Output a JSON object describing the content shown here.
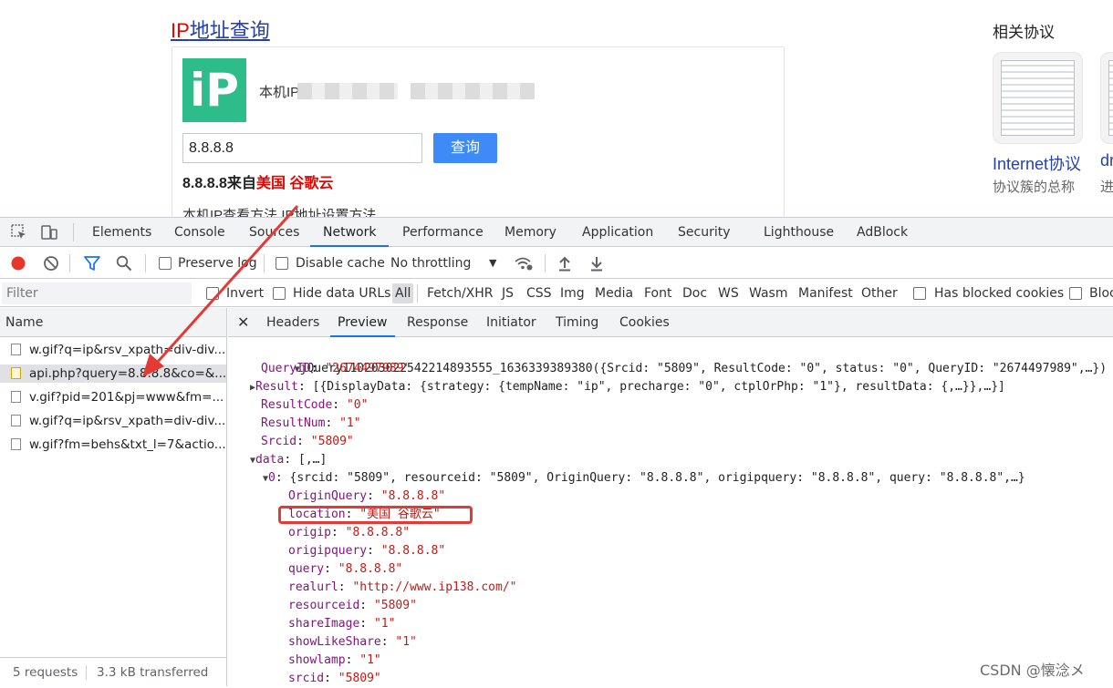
{
  "webpage": {
    "title_ip": "IP",
    "title_rest": "地址查询",
    "logo_text": "iP",
    "local_ip_label": "本机IP",
    "search_value": "8.8.8.8",
    "search_button": "查询",
    "result_prefix": "8.8.8.8来自",
    "result_location": "美国 谷歌云",
    "method_text": "本机IP查看方法 IP地址设置方法",
    "side_title": "相关协议",
    "side_link": "Internet协议",
    "side_link2": "dr",
    "side_desc": "协议簇的总称",
    "side_desc2": "进"
  },
  "devtools": {
    "tabs": [
      "Elements",
      "Console",
      "Sources",
      "Network",
      "Performance",
      "Memory",
      "Application",
      "Security",
      "Lighthouse",
      "AdBlock"
    ],
    "active_tab": "Network",
    "toolbar": {
      "preserve_log": "Preserve log",
      "disable_cache": "Disable cache",
      "throttling": "No throttling"
    },
    "filter": {
      "placeholder": "Filter",
      "invert": "Invert",
      "hide_data_urls": "Hide data URLs",
      "types": [
        "All",
        "Fetch/XHR",
        "JS",
        "CSS",
        "Img",
        "Media",
        "Font",
        "Doc",
        "WS",
        "Wasm",
        "Manifest",
        "Other"
      ],
      "has_blocked_cookies": "Has blocked cookies",
      "blocked_requests": "Bloc"
    },
    "requests_header": "Name",
    "requests": [
      {
        "name": "w.gif?q=ip&rsv_xpath=div-div...",
        "type": "file"
      },
      {
        "name": "api.php?query=8.8.8.8&co=&...",
        "type": "script"
      },
      {
        "name": "v.gif?pid=201&pj=www&fm=...",
        "type": "file"
      },
      {
        "name": "w.gif?q=ip&rsv_xpath=div-div...",
        "type": "file"
      },
      {
        "name": "w.gif?fm=behs&txt_l=7&actio...",
        "type": "file"
      }
    ],
    "summary_requests": "5 requests",
    "summary_transferred": "3.3 kB transferred",
    "detail_tabs": [
      "Headers",
      "Preview",
      "Response",
      "Initiator",
      "Timing",
      "Cookies"
    ],
    "active_detail_tab": "Preview",
    "preview": {
      "root": "jQuery110203022542214893555_1636339389380({Srcid: \"5809\", ResultCode: \"0\", status: \"0\", QueryID: \"2674497989\",…})",
      "lines": [
        {
          "key": "QueryID",
          "value": "\"2674497989\"",
          "indent": 1,
          "toggle": ""
        },
        {
          "key": "Result",
          "value": "[{DisplayData: {strategy: {tempName: \"ip\", precharge: \"0\", ctplOrPhp: \"1\"}, resultData: {,…}},…}]",
          "indent": 1,
          "toggle": "▶"
        },
        {
          "key": "ResultCode",
          "value": "\"0\"",
          "indent": 1,
          "toggle": ""
        },
        {
          "key": "ResultNum",
          "value": "\"1\"",
          "indent": 1,
          "toggle": ""
        },
        {
          "key": "Srcid",
          "value": "\"5809\"",
          "indent": 1,
          "toggle": ""
        },
        {
          "key": "data",
          "value": "[,…]",
          "indent": 1,
          "toggle": "▼"
        },
        {
          "key": "0",
          "value": "{srcid: \"5809\", resourceid: \"5809\", OriginQuery: \"8.8.8.8\", origipquery: \"8.8.8.8\", query: \"8.8.8.8\",…}",
          "indent": 2,
          "toggle": "▼"
        },
        {
          "key": "OriginQuery",
          "value": "\"8.8.8.8\"",
          "indent": 3,
          "toggle": ""
        },
        {
          "key": "location",
          "value": "\"美国 谷歌云\"",
          "indent": 3,
          "toggle": ""
        },
        {
          "key": "origip",
          "value": "\"8.8.8.8\"",
          "indent": 3,
          "toggle": ""
        },
        {
          "key": "origipquery",
          "value": "\"8.8.8.8\"",
          "indent": 3,
          "toggle": ""
        },
        {
          "key": "query",
          "value": "\"8.8.8.8\"",
          "indent": 3,
          "toggle": ""
        },
        {
          "key": "realurl",
          "value": "\"http://www.ip138.com/\"",
          "indent": 3,
          "toggle": ""
        },
        {
          "key": "resourceid",
          "value": "\"5809\"",
          "indent": 3,
          "toggle": ""
        },
        {
          "key": "shareImage",
          "value": "\"1\"",
          "indent": 3,
          "toggle": ""
        },
        {
          "key": "showLikeShare",
          "value": "\"1\"",
          "indent": 3,
          "toggle": ""
        },
        {
          "key": "showlamp",
          "value": "\"1\"",
          "indent": 3,
          "toggle": ""
        },
        {
          "key": "srcid",
          "value": "\"5809\"",
          "indent": 3,
          "toggle": ""
        }
      ]
    }
  },
  "watermark": "CSDN @懐淰メ",
  "colors": {
    "accent": "#1a73e8",
    "annotation_red": "#e53935",
    "json_key": "#881280",
    "json_string": "#c41a16",
    "logo_green": "#2dbd8a",
    "search_button": "#3e8bf7"
  }
}
